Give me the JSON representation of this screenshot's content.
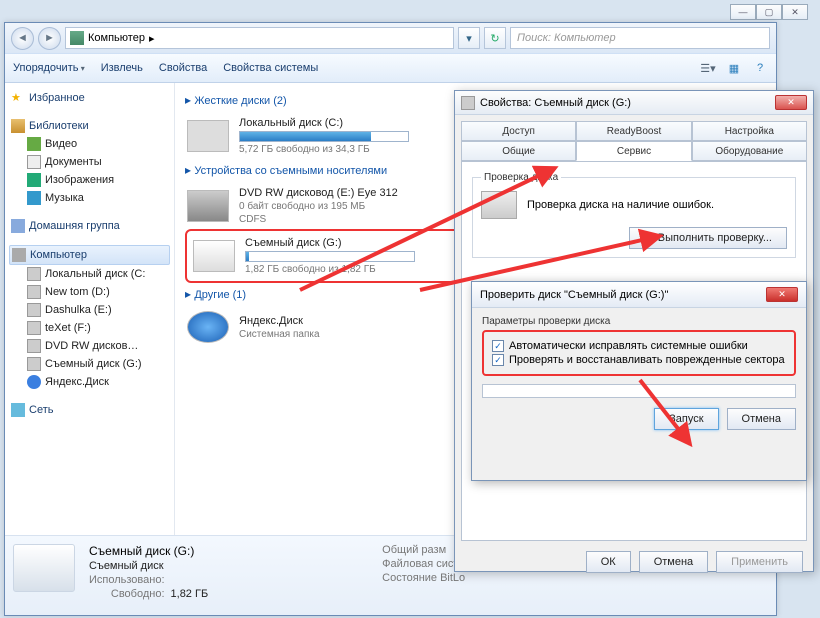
{
  "window_controls": {
    "min": "—",
    "max": "▢",
    "close": "✕"
  },
  "address": {
    "root": "Компьютер",
    "sep": "▸",
    "search_placeholder": "Поиск: Компьютер"
  },
  "toolbar": {
    "organize": "Упорядочить",
    "extract": "Извлечь",
    "props": "Свойства",
    "sysprops": "Свойства системы"
  },
  "sidebar": {
    "fav": "Избранное",
    "lib": "Библиотеки",
    "lib_items": [
      "Видео",
      "Документы",
      "Изображения",
      "Музыка"
    ],
    "hg": "Домашняя группа",
    "comp": "Компьютер",
    "comp_items": [
      "Локальный диск (C:",
      "New tom (D:)",
      "Dashulka (E:)",
      "teXet (F:)",
      "DVD RW дисков…",
      "Съемный диск (G:)",
      "Яндекс.Диск"
    ],
    "net": "Сеть"
  },
  "content": {
    "cat1": "Жесткие диски (2)",
    "d1": {
      "title": "Локальный диск (C:)",
      "sub": "5,72 ГБ свободно из 34,3 ГБ",
      "fill": 78
    },
    "cat2": "Устройства со съемными носителями",
    "d2": {
      "title": "DVD RW дисковод (E:) Eye 312",
      "sub": "0 байт свободно из 195 МБ",
      "fs": "CDFS"
    },
    "d3": {
      "title": "Съемный диск (G:)",
      "sub": "1,82 ГБ свободно из 1,82 ГБ",
      "fill": 2
    },
    "cat3": "Другие (1)",
    "d4": {
      "title": "Яндекс.Диск",
      "sub": "Системная папка"
    }
  },
  "details": {
    "title": "Съемный диск (G:)",
    "rows": [
      [
        "Съемный диск",
        "Общий разм"
      ],
      [
        "Использовано:",
        "Файловая система"
      ],
      [
        "Свободно:",
        "Состояние BitLo"
      ],
      [
        "1,82 ГБ",
        ""
      ]
    ]
  },
  "propwin": {
    "title": "Свойства: Съемный диск (G:)",
    "tabs_top": [
      "Доступ",
      "ReadyBoost",
      "Настройка"
    ],
    "tabs_bot": [
      "Общие",
      "Сервис",
      "Оборудование"
    ],
    "fs_check": "Проверка диска",
    "check_desc": "Проверка диска на наличие ошибок.",
    "btn_check": "Выполнить проверку...",
    "ok": "ОК",
    "cancel": "Отмена",
    "apply": "Применить"
  },
  "checkwin": {
    "title": "Проверить диск \"Съемный диск (G:)\"",
    "fs": "Параметры проверки диска",
    "opt1": "Автоматически исправлять системные ошибки",
    "opt2": "Проверять и восстанавливать поврежденные сектора",
    "start": "Запуск",
    "cancel": "Отмена"
  }
}
